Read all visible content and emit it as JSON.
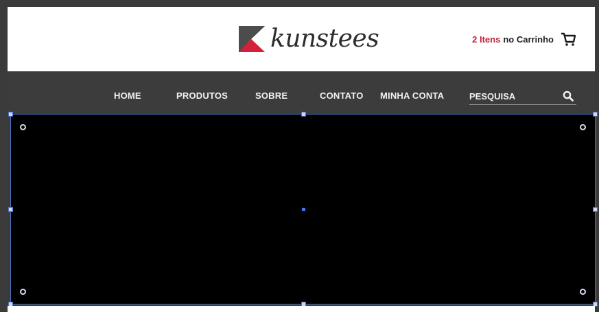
{
  "header": {
    "logo_text": "kunstees",
    "cart": {
      "count_label": "2 Itens",
      "suffix_label": "no Carrinho",
      "accent_color": "#c0223b",
      "icon": "shopping-cart-icon"
    }
  },
  "nav": {
    "items": [
      {
        "label": "HOME"
      },
      {
        "label": "PRODUTOS"
      },
      {
        "label": "SOBRE"
      },
      {
        "label": "CONTATO"
      },
      {
        "label": "MINHA CONTA"
      }
    ],
    "search": {
      "placeholder": "PESQUISA",
      "icon": "search-icon"
    }
  },
  "colors": {
    "nav_background": "#3c3c3c",
    "header_background": "#ffffff",
    "selection_border": "#4a73c9",
    "canvas_background": "#000000"
  }
}
